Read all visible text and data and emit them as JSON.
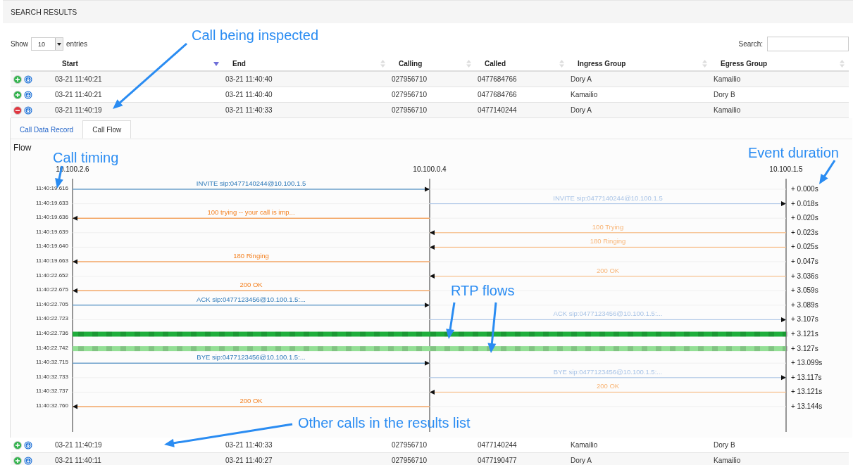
{
  "header": {
    "title": "SEARCH RESULTS"
  },
  "length_control": {
    "show_label": "Show",
    "value": "10",
    "entries_label": "entries"
  },
  "search": {
    "label": "Search:"
  },
  "table": {
    "columns": [
      {
        "label": "Start",
        "sorted": true
      },
      {
        "label": "End",
        "sorted": false
      },
      {
        "label": "Calling",
        "sorted": false
      },
      {
        "label": "Called",
        "sorted": false
      },
      {
        "label": "Ingress Group",
        "sorted": false
      },
      {
        "label": "Egress Group",
        "sorted": false
      }
    ],
    "rows": [
      {
        "expanded": false,
        "cells": [
          "03-21 11:40:21",
          "03-21 11:40:40",
          "027956710",
          "0477684766",
          "Dory A",
          "Kamailio"
        ]
      },
      {
        "expanded": false,
        "cells": [
          "03-21 11:40:21",
          "03-21 11:40:40",
          "027956710",
          "0477684766",
          "Kamailio",
          "Dory B"
        ]
      },
      {
        "expanded": true,
        "cells": [
          "03-21 11:40:19",
          "03-21 11:40:33",
          "027956710",
          "0477140244",
          "Dory A",
          "Kamailio"
        ]
      },
      {
        "expanded": false,
        "cells": [
          "03-21 11:40:19",
          "03-21 11:40:33",
          "027956710",
          "0477140244",
          "Kamailio",
          "Dory B"
        ]
      },
      {
        "expanded": false,
        "cells": [
          "03-21 11:40:11",
          "03-21 11:40:27",
          "027956710",
          "0477190477",
          "Dory A",
          "Kamailio"
        ]
      }
    ]
  },
  "detail": {
    "tabs": [
      {
        "label": "Call Data Record",
        "selected": false
      },
      {
        "label": "Call Flow",
        "selected": true
      }
    ],
    "flow": {
      "title": "Flow",
      "nodes": [
        "10.100.2.6",
        "10.100.0.4",
        "10.100.1.5"
      ],
      "messages": [
        {
          "time": "11:40:19.616",
          "offset": "+ 0.000s",
          "kind": "request",
          "second_hop": false,
          "forward": true,
          "label": "INVITE sip:0477140244@10.100.1.5"
        },
        {
          "time": "11:40:19.633",
          "offset": "+ 0.018s",
          "kind": "request",
          "second_hop": true,
          "forward": true,
          "label": "INVITE sip:0477140244@10.100.1.5"
        },
        {
          "time": "11:40:19.636",
          "offset": "+ 0.020s",
          "kind": "response",
          "second_hop": false,
          "forward": false,
          "label": "100 trying -- your call is imp..."
        },
        {
          "time": "11:40:19.639",
          "offset": "+ 0.023s",
          "kind": "response",
          "second_hop": true,
          "forward": false,
          "label": "100 Trying"
        },
        {
          "time": "11:40:19.640",
          "offset": "+ 0.025s",
          "kind": "response",
          "second_hop": true,
          "forward": false,
          "label": "180 Ringing"
        },
        {
          "time": "11:40:19.663",
          "offset": "+ 0.047s",
          "kind": "response",
          "second_hop": false,
          "forward": false,
          "label": "180 Ringing"
        },
        {
          "time": "11:40:22.652",
          "offset": "+ 3.036s",
          "kind": "response",
          "second_hop": true,
          "forward": false,
          "label": "200 OK"
        },
        {
          "time": "11:40:22.675",
          "offset": "+ 3.059s",
          "kind": "response",
          "second_hop": false,
          "forward": false,
          "label": "200 OK"
        },
        {
          "time": "11:40:22.705",
          "offset": "+ 3.089s",
          "kind": "request",
          "second_hop": false,
          "forward": true,
          "label": "ACK sip:0477123456@10.100.1.5:..."
        },
        {
          "time": "11:40:22.723",
          "offset": "+ 3.107s",
          "kind": "request",
          "second_hop": true,
          "forward": true,
          "label": "ACK sip:0477123456@10.100.1.5:..."
        },
        {
          "time": "11:40:22.736",
          "offset": "+ 3.121s",
          "kind": "rtp",
          "color": "#1fae3c"
        },
        {
          "time": "11:40:22.742",
          "offset": "+ 3.127s",
          "kind": "rtp",
          "color": "#93df95"
        },
        {
          "time": "11:40:32.715",
          "offset": "+ 13.099s",
          "kind": "request",
          "second_hop": false,
          "forward": true,
          "label": "BYE sip:0477123456@10.100.1.5:..."
        },
        {
          "time": "11:40:32.733",
          "offset": "+ 13.117s",
          "kind": "request",
          "second_hop": true,
          "forward": true,
          "label": "BYE sip:0477123456@10.100.1.5:..."
        },
        {
          "time": "11:40:32.737",
          "offset": "+ 13.121s",
          "kind": "response",
          "second_hop": true,
          "forward": false,
          "label": "200 OK"
        },
        {
          "time": "11:40:32.760",
          "offset": "+ 13.144s",
          "kind": "response",
          "second_hop": false,
          "forward": false,
          "label": "200 OK"
        }
      ]
    }
  },
  "annotations": [
    {
      "text": "Call being inspected"
    },
    {
      "text": "Call timing"
    },
    {
      "text": "Event duration"
    },
    {
      "text": "RTP flows"
    },
    {
      "text": "Other calls in the results list"
    }
  ]
}
